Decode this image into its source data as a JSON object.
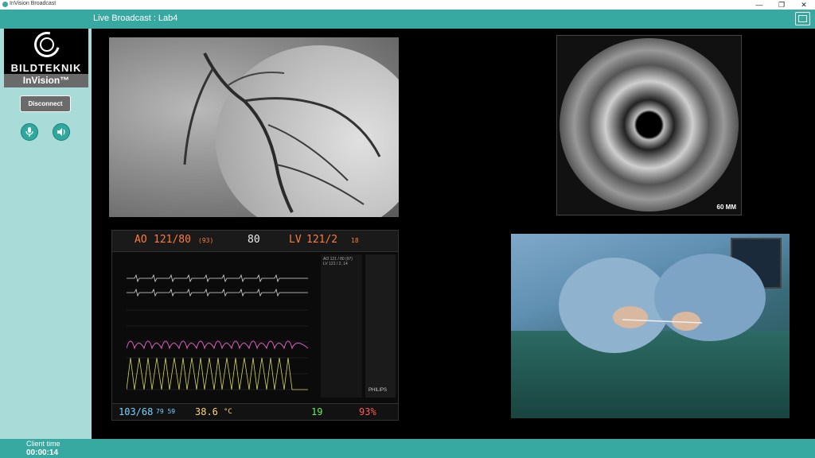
{
  "window": {
    "title": "InVision Broadcast"
  },
  "header": {
    "title": "Live Broadcast : Lab4"
  },
  "sidebar": {
    "brand": "BILDTEKNIK",
    "product": "InVision™",
    "disconnect_label": "Disconnect"
  },
  "footer": {
    "clock_label": "Client  time",
    "clock_value": "00:00:14"
  },
  "ivus": {
    "scale_label": "60 MM"
  },
  "monitor": {
    "ao_label": "AO",
    "ao_value": "121/80",
    "ao_mean": "(93)",
    "hr_value": "80",
    "lv_label": "LV",
    "lv_value": "121/2",
    "lv_extra": "18",
    "side_info_1": "AO 121 / 80 (97)",
    "side_info_2": "LV 121 / 2, 14",
    "nibp": "103/68",
    "spo2_small": "79 59",
    "temp": "38.6",
    "temp_unit": "°C",
    "resp": "19",
    "spo2": "93%",
    "brand": "PHILIPS"
  },
  "colors": {
    "accent": "#37a9a1",
    "sidebar": "#a9dcd8"
  }
}
